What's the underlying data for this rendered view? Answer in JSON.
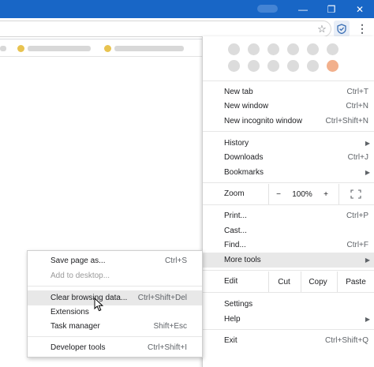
{
  "window": {
    "controls": {
      "minimize": "—",
      "restore": "❐",
      "close": "✕"
    }
  },
  "toolbar": {
    "star_icon": "☆",
    "extension_icon": "shield-check",
    "menu_icon": "⋮"
  },
  "menu": {
    "new_tab": {
      "label": "New tab",
      "shortcut": "Ctrl+T"
    },
    "new_window": {
      "label": "New window",
      "shortcut": "Ctrl+N"
    },
    "new_incognito": {
      "label": "New incognito window",
      "shortcut": "Ctrl+Shift+N"
    },
    "history": {
      "label": "History"
    },
    "downloads": {
      "label": "Downloads",
      "shortcut": "Ctrl+J"
    },
    "bookmarks": {
      "label": "Bookmarks"
    },
    "zoom": {
      "label": "Zoom",
      "minus": "−",
      "value": "100%",
      "plus": "+",
      "fullscreen": "⛶"
    },
    "print": {
      "label": "Print...",
      "shortcut": "Ctrl+P"
    },
    "cast": {
      "label": "Cast..."
    },
    "find": {
      "label": "Find...",
      "shortcut": "Ctrl+F"
    },
    "more_tools": {
      "label": "More tools"
    },
    "edit": {
      "label": "Edit",
      "cut": "Cut",
      "copy": "Copy",
      "paste": "Paste"
    },
    "settings": {
      "label": "Settings"
    },
    "help": {
      "label": "Help"
    },
    "exit": {
      "label": "Exit",
      "shortcut": "Ctrl+Shift+Q"
    }
  },
  "submenu": {
    "save_page": {
      "label": "Save page as...",
      "shortcut": "Ctrl+S"
    },
    "add_desktop": {
      "label": "Add to desktop..."
    },
    "clear_data": {
      "label": "Clear browsing data...",
      "shortcut": "Ctrl+Shift+Del"
    },
    "extensions": {
      "label": "Extensions"
    },
    "task_manager": {
      "label": "Task manager",
      "shortcut": "Shift+Esc"
    },
    "dev_tools": {
      "label": "Developer tools",
      "shortcut": "Ctrl+Shift+I"
    }
  },
  "colors": {
    "titlebar": "#1866c6",
    "hover": "#e8e8e8",
    "disabled": "#9a9a9a"
  }
}
